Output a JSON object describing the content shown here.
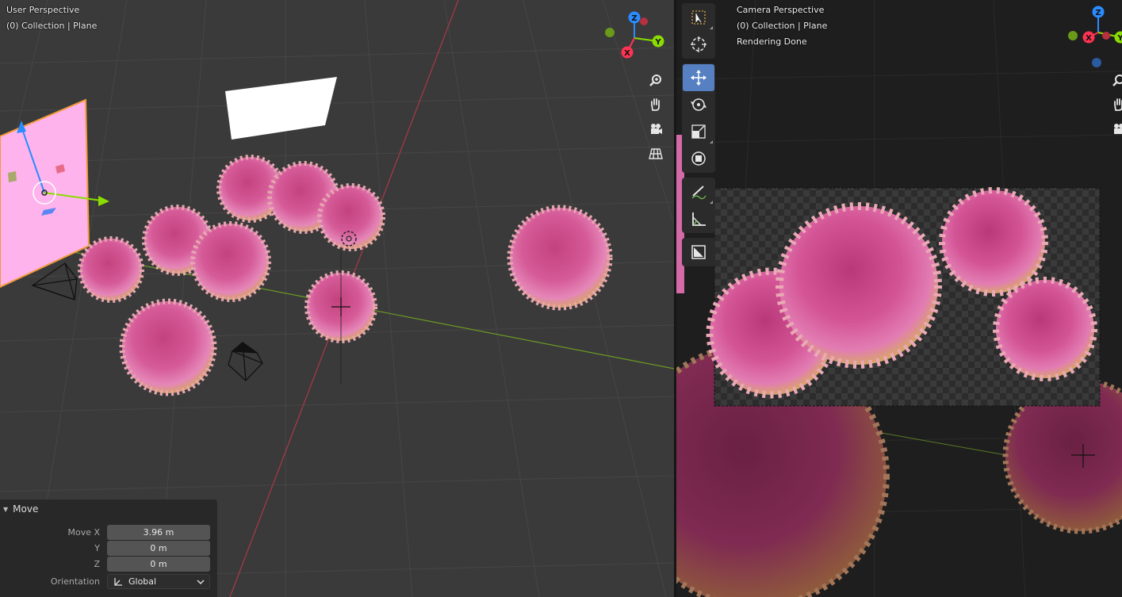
{
  "left_viewport": {
    "perspective": "User Perspective",
    "collection": "(0) Collection | Plane",
    "gizmo_axes": {
      "z": "Z",
      "y": "Y",
      "x": "X"
    },
    "nav_icons": [
      "zoom-icon",
      "hand-icon",
      "camera-icon",
      "grid-icon"
    ]
  },
  "right_viewport": {
    "perspective": "Camera Perspective",
    "collection": "(0) Collection | Plane",
    "status": "Rendering Done",
    "gizmo_axes": {
      "z": "Z",
      "y": "Y",
      "x": "X"
    }
  },
  "toolbar": {
    "tools": [
      "select-box-icon",
      "cursor-icon",
      "move-icon",
      "rotate-icon",
      "scale-icon",
      "transform-icon",
      "annotate-icon",
      "measure-icon",
      "add-cube-icon"
    ],
    "active_tool": "move-icon"
  },
  "operator_panel": {
    "title": "Move",
    "move_x_label": "Move X",
    "move_x_value": "3.96 m",
    "y_label": "Y",
    "y_value": "0 m",
    "z_label": "Z",
    "z_value": "0 m",
    "orientation_label": "Orientation",
    "orientation_value": "Global"
  },
  "colors": {
    "axis_x": "#ff3352",
    "axis_y": "#8bdc00",
    "axis_z": "#2890ff",
    "active_tool": "#5680c2",
    "virus": "#e25fa6"
  }
}
